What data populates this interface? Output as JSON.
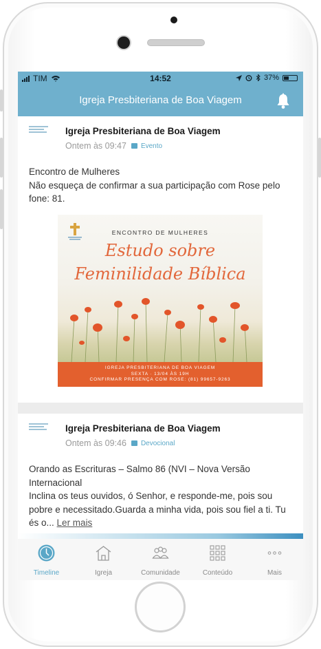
{
  "status_bar": {
    "carrier": "TIM",
    "time": "14:52",
    "battery": "37%",
    "battery_level": 0.37
  },
  "header": {
    "title": "Igreja Presbiteriana de Boa Viagem"
  },
  "posts": [
    {
      "author": "Igreja Presbiteriana de Boa Viagem",
      "time": "Ontem às 09:47",
      "tag": "Evento",
      "lines": [
        "Encontro de Mulheres",
        "Não esqueça de confirmar a sua participação com Rose pelo fone: 81."
      ],
      "poster": {
        "heading": "ENCONTRO DE MULHERES",
        "script_line1": "Estudo sobre",
        "script_line2": "Feminilidade Bíblica",
        "footer_line1": "IGREJA PRESBITERIANA DE BOA VIAGEM",
        "footer_line2": "SEXTA · 13/04 ÀS 19H",
        "footer_line3": "CONFIRMAR PRESENÇA COM ROSE: (81) 99657-9263",
        "accent_color": "#e3602e"
      }
    },
    {
      "author": "Igreja Presbiteriana de Boa Viagem",
      "time": "Ontem às 09:46",
      "tag": "Devocional",
      "line1": "Orando as Escrituras – Salmo 86 (NVI – Nova Versão Internacional",
      "line2": "Inclina os teus ouvidos, ó Senhor, e responde-me, pois sou pobre e necessitado.Guarda a minha vida, pois sou fiel a ti. Tu és o...",
      "read_more": "Ler mais"
    }
  ],
  "tabs": [
    {
      "label": "Timeline",
      "icon": "clock-icon",
      "active": true
    },
    {
      "label": "Igreja",
      "icon": "church-icon",
      "active": false
    },
    {
      "label": "Comunidade",
      "icon": "people-icon",
      "active": false
    },
    {
      "label": "Conteúdo",
      "icon": "grid-icon",
      "active": false
    },
    {
      "label": "Mais",
      "icon": "more-dots-icon",
      "active": false
    }
  ],
  "colors": {
    "accent": "#6fb0cd",
    "tab_active": "#5aa7c7"
  }
}
